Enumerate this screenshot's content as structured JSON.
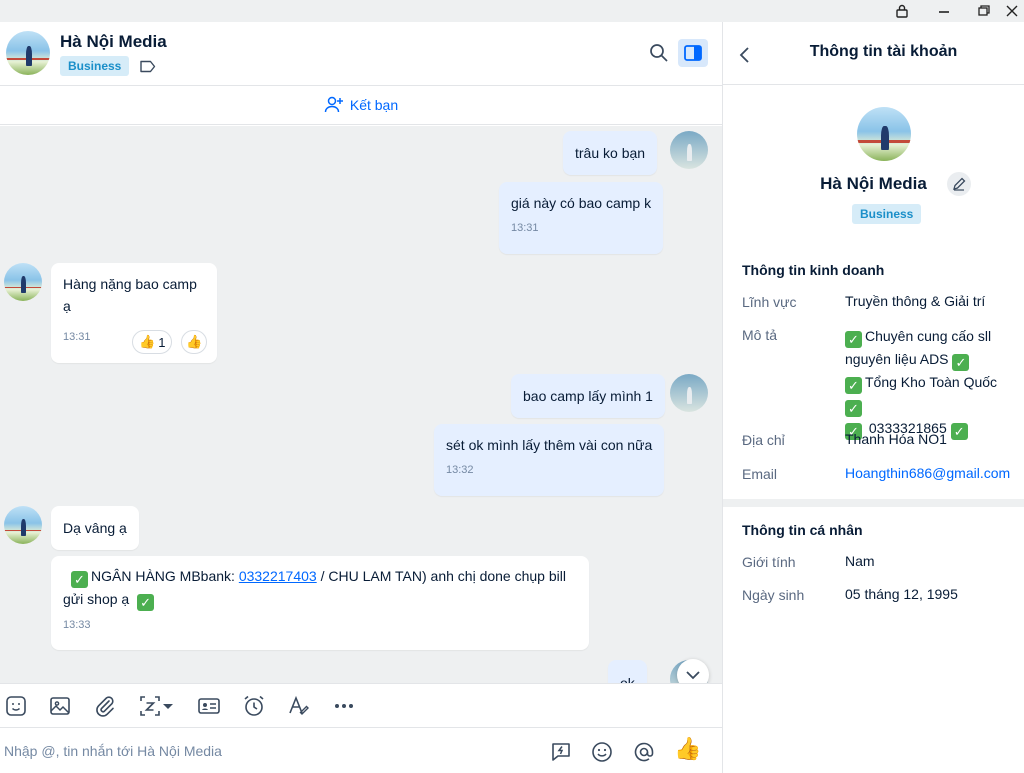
{
  "chat": {
    "contact_name": "Hà Nội Media",
    "contact_badge": "Business",
    "add_friend_label": "Kết bạn",
    "composer_placeholder": "Nhập @, tin nhắn tới Hà Nội Media",
    "messages": [
      {
        "from": "me",
        "text": "trâu  ko bạn"
      },
      {
        "from": "me",
        "text": "giá này có bao camp k",
        "time": "13:31"
      },
      {
        "from": "them",
        "text": "Hàng nặng bao camp ạ",
        "time": "13:31",
        "reaction_count": "1"
      },
      {
        "from": "me",
        "text": "bao camp lấy mình 1"
      },
      {
        "from": "me",
        "text": "sét ok mình lấy thêm vài con nữa",
        "time": "13:32"
      },
      {
        "from": "them",
        "text": "Dạ vâng ạ"
      },
      {
        "from": "them",
        "text_prefix": "NGÂN HÀNG MBbank: ",
        "link": "0332217403",
        "text_suffix": " / CHU LAM TAN) anh chị  done chụp bill",
        "text_line2": "gửi shop ạ",
        "time": "13:33"
      },
      {
        "from": "me",
        "text": "ok"
      }
    ]
  },
  "info": {
    "title": "Thông tin tài khoản",
    "name": "Hà Nội Media",
    "badge": "Business",
    "business_section": "Thông tin kinh doanh",
    "field_label": "Lĩnh vực",
    "field_value": "Truyền thông & Giải trí",
    "desc_label": "Mô tả",
    "desc_line1": "Chuyên cung cấo sll",
    "desc_line2": "nguyên liệu ADS",
    "desc_line3": "Tổng Kho Toàn Quốc",
    "desc_line4": "0333321865",
    "address_label": "Địa chỉ",
    "address_value": "Thanh Hóa NO1",
    "email_label": "Email",
    "email_value": "Hoangthin686@gmail.com",
    "personal_section": "Thông tin cá nhân",
    "gender_label": "Giới tính",
    "gender_value": "Nam",
    "dob_label": "Ngày sinh",
    "dob_value": "05 tháng 12, 1995"
  },
  "colors": {
    "accent": "#0068ff",
    "my_bubble": "#e5efff",
    "chat_bg": "#eef0f1",
    "badge_bg": "#d6ecf8",
    "check_green": "#4caf50"
  }
}
